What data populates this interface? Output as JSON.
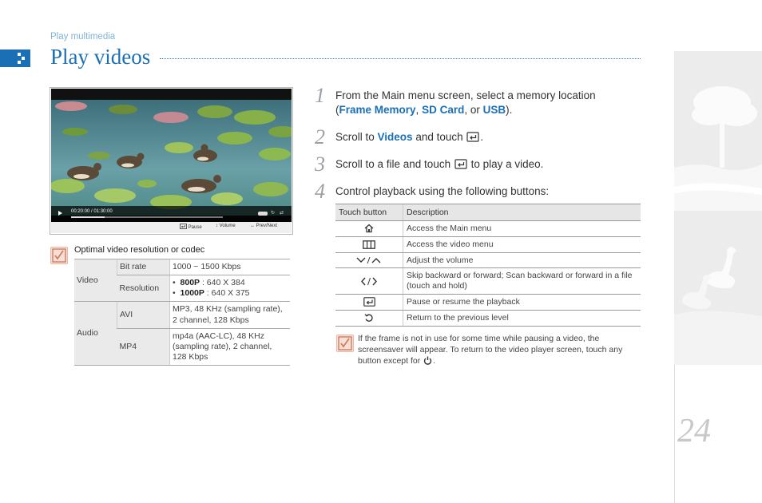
{
  "header": {
    "section_label": "Play multimedia",
    "title": "Play videos"
  },
  "page_number": "24",
  "screenshot": {
    "time": "00:20:00 / 01:30:00",
    "progress": 0.22,
    "buttons": {
      "pause": "Pause",
      "volume": "Volume",
      "prev_next": "Prev/Next"
    }
  },
  "resolution_note": {
    "title": "Optimal video resolution or codec",
    "video_label": "Video",
    "bit_rate_label": "Bit rate",
    "bit_rate_value": "1000 ~ 1500 Kbps",
    "resolution_label": "Resolution",
    "res1_name": "800P",
    "res1_value": " : 640 X 384",
    "res2_name": "1000P",
    "res2_value": " : 640 X 375",
    "audio_label": "Audio",
    "avi_label": "AVI",
    "avi_value": "MP3, 48 KHz (sampling rate), 2 channel, 128 Kbps",
    "mp4_label": "MP4",
    "mp4_value": "mp4a (AAC-LC), 48 KHz (sampling rate), 2 channel, 128 Kbps"
  },
  "steps": [
    {
      "num": "1",
      "line1": "From the Main menu screen, select a memory location",
      "open": "(",
      "opt1": "Frame Memory",
      "sep1": ", ",
      "opt2": "SD Card",
      "sep2": ", or ",
      "opt3": "USB",
      "close": ")."
    },
    {
      "num": "2",
      "pre": "Scroll to ",
      "hl": "Videos",
      "post": " and touch ",
      "end": "."
    },
    {
      "num": "3",
      "pre": "Scroll to a file and touch ",
      "post": " to play a video."
    },
    {
      "num": "4",
      "text": "Control playback using the following buttons:"
    }
  ],
  "buttons_table": {
    "col_button": "Touch button",
    "col_desc": "Description",
    "rows": [
      {
        "icon": "home-icon",
        "desc": "Access the Main menu"
      },
      {
        "icon": "video-menu-icon",
        "desc": "Access the video menu"
      },
      {
        "icon": "volume-down-up-icon",
        "desc": "Adjust the volume"
      },
      {
        "icon": "left-right-icon",
        "desc": "Skip backward or forward; Scan backward or forward in a file (touch and hold)"
      },
      {
        "icon": "enter-icon",
        "desc": "Pause or resume the playback"
      },
      {
        "icon": "back-icon",
        "desc": "Return to the previous level"
      }
    ]
  },
  "bottom_note": {
    "text": "If the frame is not in use for some time while pausing a video, the screensaver will appear. To return to the video player screen, touch any button except for ",
    "end": "."
  },
  "colors": {
    "accent": "#1a6fb5",
    "note_icon": "#d9734f",
    "side_panel": "#ececec"
  }
}
